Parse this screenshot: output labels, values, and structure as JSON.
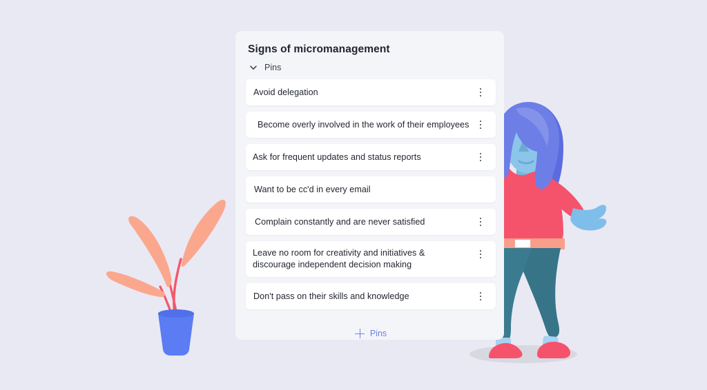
{
  "page": {
    "background_color": "#e9e9f4"
  },
  "card": {
    "title": "Signs of micromanagement",
    "background_color": "#f4f5f8",
    "group": {
      "label": "Pins",
      "expanded": true,
      "chevron_icon": "chevron-down-icon"
    },
    "rows": [
      {
        "text": "Avoid delegation",
        "menu_icon": "kebab-menu-icon",
        "menu_visible": true
      },
      {
        "text": "Become overly involved in the work of their employees",
        "menu_icon": "kebab-menu-icon",
        "menu_visible": true
      },
      {
        "text": "Ask for frequent updates and status reports",
        "menu_icon": "kebab-menu-icon",
        "menu_visible": true
      },
      {
        "text": "Want to be cc'd in every email",
        "menu_icon": "kebab-menu-icon",
        "menu_visible": false
      },
      {
        "text": "Complain constantly and are never satisfied",
        "menu_icon": "kebab-menu-icon",
        "menu_visible": true
      },
      {
        "text": "Leave no room for creativity and initiatives & discourage independent decision making",
        "menu_icon": "kebab-menu-icon",
        "menu_visible": true
      },
      {
        "text": "Don't pass on their skills and knowledge",
        "menu_icon": "kebab-menu-icon",
        "menu_visible": true
      }
    ],
    "add_button": {
      "label": "Pins",
      "icon": "plus-icon",
      "color": "#6c7ff0"
    }
  },
  "illustration": {
    "plant": {
      "name": "potted-plant-illustration",
      "leaf_color": "#fba78d",
      "stem_color": "#f4566a",
      "pot_color": "#5b7cf3",
      "pot_rim_color": "#4f70ea"
    },
    "person": {
      "name": "woman-holding-tablet-illustration",
      "hair_color": "#5a6ce0",
      "hair_highlight_color": "#8492ea",
      "skin_color": "#8cc5ea",
      "top_color": "#f5536c",
      "pants_color": "#3b7b90",
      "shoe_color": "#f5536c",
      "sock_color": "#a8d1f2",
      "tablet_color": "#2f2f31",
      "belt_color": "#f79f8b",
      "shadow_color": "#d8d8e1"
    }
  }
}
